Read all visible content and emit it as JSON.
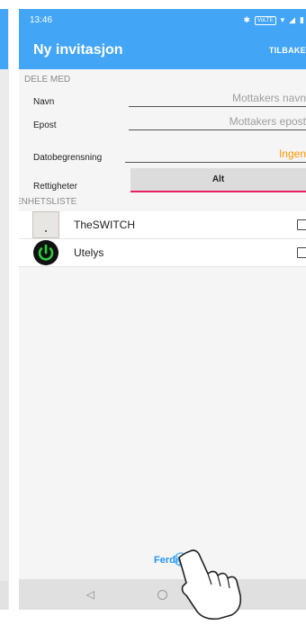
{
  "status_bar": {
    "time": "13:46",
    "volte": "VoLTE"
  },
  "app_bar": {
    "title": "Ny invitasjon",
    "back_label": "TILBAKE"
  },
  "share": {
    "header": "DELE MED",
    "name_label": "Navn",
    "name_placeholder": "Mottakers navn",
    "email_label": "Epost",
    "email_placeholder": "Mottakers epost",
    "date_label": "Datobegrensning",
    "date_value": "Ingen",
    "rights_label": "Rettigheter",
    "rights_value": "Alt"
  },
  "devices": {
    "header": "ENHETSLISTE",
    "items": [
      {
        "name": "TheSWITCH",
        "checked": false
      },
      {
        "name": "Utelys",
        "checked": false
      }
    ]
  },
  "footer": {
    "done_label": "Ferdig"
  },
  "colors": {
    "primary": "#42a5f5",
    "accent": "#e91e63",
    "date": "#ff9800",
    "link": "#2196f3"
  }
}
